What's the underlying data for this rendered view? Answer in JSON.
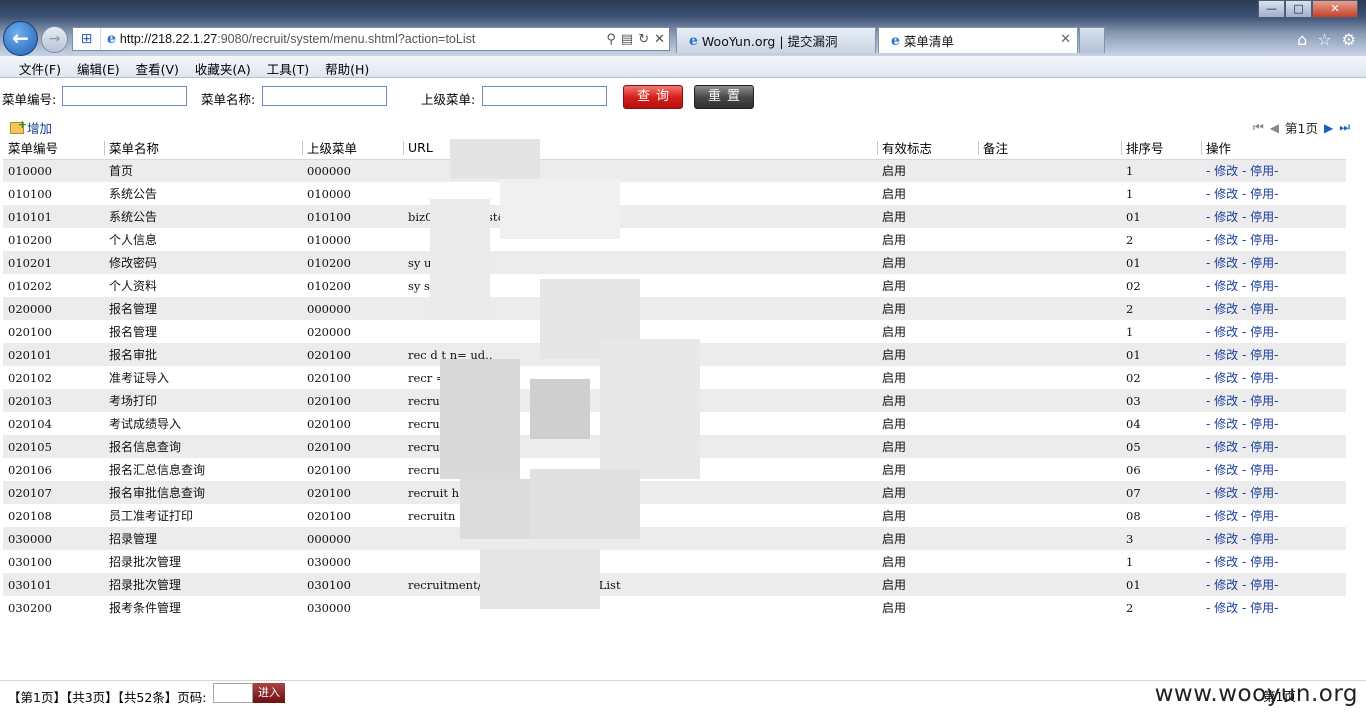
{
  "browser": {
    "url_host": "http://218.22.1.27",
    "url_rest": ":9080/recruit/system/menu.shtml?action=toList",
    "tabs": [
      {
        "label": "WooYun.org | 提交漏洞"
      },
      {
        "label": "菜单清单"
      }
    ],
    "menu": [
      "文件(F)",
      "编辑(E)",
      "查看(V)",
      "收藏夹(A)",
      "工具(T)",
      "帮助(H)"
    ],
    "win_buttons": {
      "min": "—",
      "max": "□",
      "close": "✕"
    }
  },
  "search": {
    "menu_code_label": "菜单编号:",
    "menu_code_value": "",
    "menu_name_label": "菜单名称:",
    "menu_name_value": "",
    "parent_label": "上级菜单:",
    "parent_value": "",
    "query_button": "查询",
    "reset_button": "重置"
  },
  "toolbar": {
    "add_label": "增加",
    "page_label": "第1页"
  },
  "table": {
    "columns": [
      "菜单编号",
      "菜单名称",
      "上级菜单",
      "URL",
      "有效标志",
      "备注",
      "排序号",
      "操作"
    ],
    "rows": [
      {
        "code": "010000",
        "name": "首页",
        "parent": "000000",
        "url": "",
        "status": "启用",
        "remark": "",
        "sort": "1"
      },
      {
        "code": "010100",
        "name": "系统公告",
        "parent": "010000",
        "url": "",
        "status": "启用",
        "remark": "",
        "sort": "1"
      },
      {
        "code": "010101",
        "name": "系统公告",
        "parent": "010100",
        "url": "biz0          101.sht                  ist&flag=1",
        "status": "启用",
        "remark": "",
        "sort": "01"
      },
      {
        "code": "010200",
        "name": "个人信息",
        "parent": "010000",
        "url": "",
        "status": "启用",
        "remark": "",
        "sort": "2"
      },
      {
        "code": "010201",
        "name": "修改密码",
        "parent": "010200",
        "url": "sy              user.s                    oP",
        "status": "启用",
        "remark": "",
        "sort": "01"
      },
      {
        "code": "010202",
        "name": "个人资料",
        "parent": "010200",
        "url": "sy              se                        Se",
        "status": "启用",
        "remark": "",
        "sort": "02"
      },
      {
        "code": "020000",
        "name": "报名管理",
        "parent": "000000",
        "url": "",
        "status": "启用",
        "remark": "",
        "sort": "2"
      },
      {
        "code": "020100",
        "name": "报名管理",
        "parent": "020000",
        "url": "",
        "status": "启用",
        "remark": "",
        "sort": "1"
      },
      {
        "code": "020101",
        "name": "报名审批",
        "parent": "020100",
        "url": "rec               d        t          n=            ud..",
        "status": "启用",
        "remark": "",
        "sort": "01"
      },
      {
        "code": "020102",
        "name": "准考证导入",
        "parent": "020100",
        "url": "recr                                   =            eIdNo",
        "status": "启用",
        "remark": "",
        "sort": "02"
      },
      {
        "code": "020103",
        "name": "考场打印",
        "parent": "020100",
        "url": "recru                                  =            ss",
        "status": "启用",
        "remark": "",
        "sort": "03"
      },
      {
        "code": "020104",
        "name": "考试成绩导入",
        "parent": "020100",
        "url": "recrui                   o                          ore",
        "status": "启用",
        "remark": "",
        "sort": "04"
      },
      {
        "code": "020105",
        "name": "报名信息查询",
        "parent": "020100",
        "url": "recrui                   ll",
        "status": "启用",
        "remark": "",
        "sort": "05"
      },
      {
        "code": "020106",
        "name": "报名汇总信息查询",
        "parent": "020100",
        "url": "recrui                   .s                         yReportT",
        "status": "启用",
        "remark": "",
        "sort": "06"
      },
      {
        "code": "020107",
        "name": "报名审批信息查询",
        "parent": "020100",
        "url": "recruit                  h                          roll",
        "status": "启用",
        "remark": "",
        "sort": "07"
      },
      {
        "code": "020108",
        "name": "员工准考证打印",
        "parent": "020100",
        "url": "recruitn",
        "status": "启用",
        "remark": "",
        "sort": "08"
      },
      {
        "code": "030000",
        "name": "招录管理",
        "parent": "000000",
        "url": "",
        "status": "启用",
        "remark": "",
        "sort": "3"
      },
      {
        "code": "030100",
        "name": "招录批次管理",
        "parent": "030000",
        "url": "",
        "status": "启用",
        "remark": "",
        "sort": "1"
      },
      {
        "code": "030101",
        "name": "招录批次管理",
        "parent": "030100",
        "url": "recruitment/recInfo.sht         ction=toList",
        "status": "启用",
        "remark": "",
        "sort": "01"
      },
      {
        "code": "030200",
        "name": "报考条件管理",
        "parent": "030000",
        "url": "",
        "status": "启用",
        "remark": "",
        "sort": "2"
      }
    ],
    "op_prefix": "- ",
    "op_edit": "修改",
    "op_sep": " - ",
    "op_disable": "停用",
    "op_suffix": "-"
  },
  "footer": {
    "summary": "【第1页】【共3页】【共52条】页码:",
    "go_button": "进入",
    "page_label": "第1页",
    "brand": "www.wooyun.org"
  }
}
